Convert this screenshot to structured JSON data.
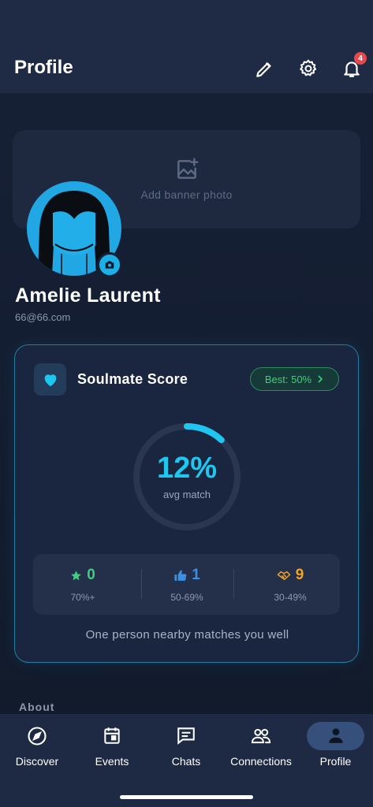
{
  "header": {
    "title": "Profile",
    "notification_count": "4",
    "icons": [
      "pencil-icon",
      "gear-icon",
      "bell-icon"
    ]
  },
  "banner": {
    "placeholder": "Add banner photo",
    "icon": "image-add-icon"
  },
  "user": {
    "name": "Amelie Laurent",
    "email": "66@66.com"
  },
  "soulmate": {
    "title": "Soulmate Score",
    "best_label": "Best: 50%",
    "score_text": "12%",
    "score_value": 12,
    "score_caption": "avg match",
    "stats": [
      {
        "icon": "star-icon",
        "count": "0",
        "range": "70%+",
        "color": "#3ecf7e"
      },
      {
        "icon": "thumbs-up-icon",
        "count": "1",
        "range": "50-69%",
        "color": "#3d8fe0"
      },
      {
        "icon": "handshake-icon",
        "count": "9",
        "range": "30-49%",
        "color": "#f0a422"
      }
    ],
    "nearby_text": "One person nearby matches you well"
  },
  "about": {
    "heading": "About"
  },
  "tabs": [
    {
      "label": "Discover",
      "icon": "compass-icon"
    },
    {
      "label": "Events",
      "icon": "calendar-icon"
    },
    {
      "label": "Chats",
      "icon": "chat-icon"
    },
    {
      "label": "Connections",
      "icon": "people-icon"
    },
    {
      "label": "Profile",
      "icon": "person-icon",
      "active": true
    }
  ],
  "colors": {
    "accent": "#1fc6ef",
    "background": "#141d2f",
    "header": "#1f2b45"
  }
}
